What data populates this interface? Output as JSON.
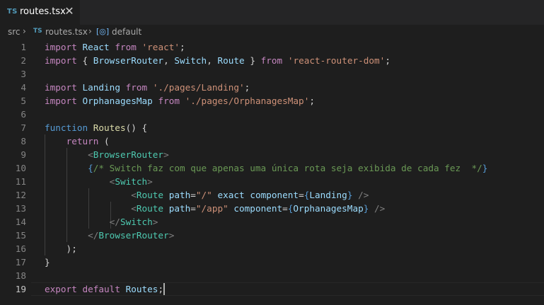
{
  "tab": {
    "badge": "TS",
    "title": "routes.tsx",
    "close_glyph": "✕",
    "icon": "typescript-file-icon"
  },
  "breadcrumb": {
    "folder": "src",
    "file_badge": "TS",
    "file": "routes.tsx",
    "symbol_glyph": "[◎]",
    "symbol": "default",
    "separator": "›"
  },
  "editor": {
    "active_line": 19,
    "line_numbers": [
      "1",
      "2",
      "3",
      "4",
      "5",
      "6",
      "7",
      "8",
      "9",
      "10",
      "11",
      "12",
      "13",
      "14",
      "15",
      "16",
      "17",
      "18",
      "19"
    ],
    "lines": [
      [
        [
          "kw",
          "import"
        ],
        [
          "df",
          " "
        ],
        [
          "vr",
          "React"
        ],
        [
          "df",
          " "
        ],
        [
          "kw",
          "from"
        ],
        [
          "df",
          " "
        ],
        [
          "st",
          "'react'"
        ],
        [
          "df",
          ";"
        ]
      ],
      [
        [
          "kw",
          "import"
        ],
        [
          "df",
          " { "
        ],
        [
          "vr",
          "BrowserRouter"
        ],
        [
          "df",
          ", "
        ],
        [
          "vr",
          "Switch"
        ],
        [
          "df",
          ", "
        ],
        [
          "vr",
          "Route"
        ],
        [
          "df",
          " } "
        ],
        [
          "kw",
          "from"
        ],
        [
          "df",
          " "
        ],
        [
          "st",
          "'react-router-dom'"
        ],
        [
          "df",
          ";"
        ]
      ],
      [],
      [
        [
          "kw",
          "import"
        ],
        [
          "df",
          " "
        ],
        [
          "vr",
          "Landing"
        ],
        [
          "df",
          " "
        ],
        [
          "kw",
          "from"
        ],
        [
          "df",
          " "
        ],
        [
          "st",
          "'./pages/Landing'"
        ],
        [
          "df",
          ";"
        ]
      ],
      [
        [
          "kw",
          "import"
        ],
        [
          "df",
          " "
        ],
        [
          "vr",
          "OrphanagesMap"
        ],
        [
          "df",
          " "
        ],
        [
          "kw",
          "from"
        ],
        [
          "df",
          " "
        ],
        [
          "st",
          "'./pages/OrphanagesMap'"
        ],
        [
          "df",
          ";"
        ]
      ],
      [],
      [
        [
          "bl",
          "function"
        ],
        [
          "df",
          " "
        ],
        [
          "fn",
          "Routes"
        ],
        [
          "df",
          "() {"
        ]
      ],
      [
        [
          "df",
          "    "
        ],
        [
          "kw",
          "return"
        ],
        [
          "df",
          " ("
        ]
      ],
      [
        [
          "df",
          "        "
        ],
        [
          "pu",
          "<"
        ],
        [
          "tg",
          "BrowserRouter"
        ],
        [
          "pu",
          ">"
        ]
      ],
      [
        [
          "df",
          "        "
        ],
        [
          "bl",
          "{"
        ],
        [
          "cm",
          "/* Switch faz com que apenas uma única rota seja exibida de cada fez  */"
        ],
        [
          "bl",
          "}"
        ]
      ],
      [
        [
          "df",
          "            "
        ],
        [
          "pu",
          "<"
        ],
        [
          "tg",
          "Switch"
        ],
        [
          "pu",
          ">"
        ]
      ],
      [
        [
          "df",
          "                "
        ],
        [
          "pu",
          "<"
        ],
        [
          "tg",
          "Route"
        ],
        [
          "df",
          " "
        ],
        [
          "vr",
          "path"
        ],
        [
          "df",
          "="
        ],
        [
          "st",
          "\"/\""
        ],
        [
          "df",
          " "
        ],
        [
          "vr",
          "exact"
        ],
        [
          "df",
          " "
        ],
        [
          "vr",
          "component"
        ],
        [
          "df",
          "="
        ],
        [
          "bl",
          "{"
        ],
        [
          "vr",
          "Landing"
        ],
        [
          "bl",
          "}"
        ],
        [
          "df",
          " "
        ],
        [
          "pu",
          "/>"
        ]
      ],
      [
        [
          "df",
          "                "
        ],
        [
          "pu",
          "<"
        ],
        [
          "tg",
          "Route"
        ],
        [
          "df",
          " "
        ],
        [
          "vr",
          "path"
        ],
        [
          "df",
          "="
        ],
        [
          "st",
          "\"/app\""
        ],
        [
          "df",
          " "
        ],
        [
          "vr",
          "component"
        ],
        [
          "df",
          "="
        ],
        [
          "bl",
          "{"
        ],
        [
          "vr",
          "OrphanagesMap"
        ],
        [
          "bl",
          "}"
        ],
        [
          "df",
          " "
        ],
        [
          "pu",
          "/>"
        ]
      ],
      [
        [
          "df",
          "            "
        ],
        [
          "pu",
          "</"
        ],
        [
          "tg",
          "Switch"
        ],
        [
          "pu",
          ">"
        ]
      ],
      [
        [
          "df",
          "        "
        ],
        [
          "pu",
          "</"
        ],
        [
          "tg",
          "BrowserRouter"
        ],
        [
          "pu",
          ">"
        ]
      ],
      [
        [
          "df",
          "    );"
        ]
      ],
      [
        [
          "df",
          "}"
        ]
      ],
      [],
      [
        [
          "kw",
          "export"
        ],
        [
          "df",
          " "
        ],
        [
          "kw",
          "default"
        ],
        [
          "df",
          " "
        ],
        [
          "vr",
          "Routes"
        ],
        [
          "df",
          ";"
        ]
      ]
    ]
  },
  "colors": {
    "background": "#1e1e1e",
    "tabbar": "#252526",
    "keyword": "#c586c0",
    "storage": "#569cd6",
    "function": "#dcdcaa",
    "variable": "#9cdcfe",
    "string": "#ce9178",
    "comment": "#6a9955",
    "tag": "#4ec9b0",
    "punctuation": "#808080",
    "ts_badge": "#519aba"
  }
}
